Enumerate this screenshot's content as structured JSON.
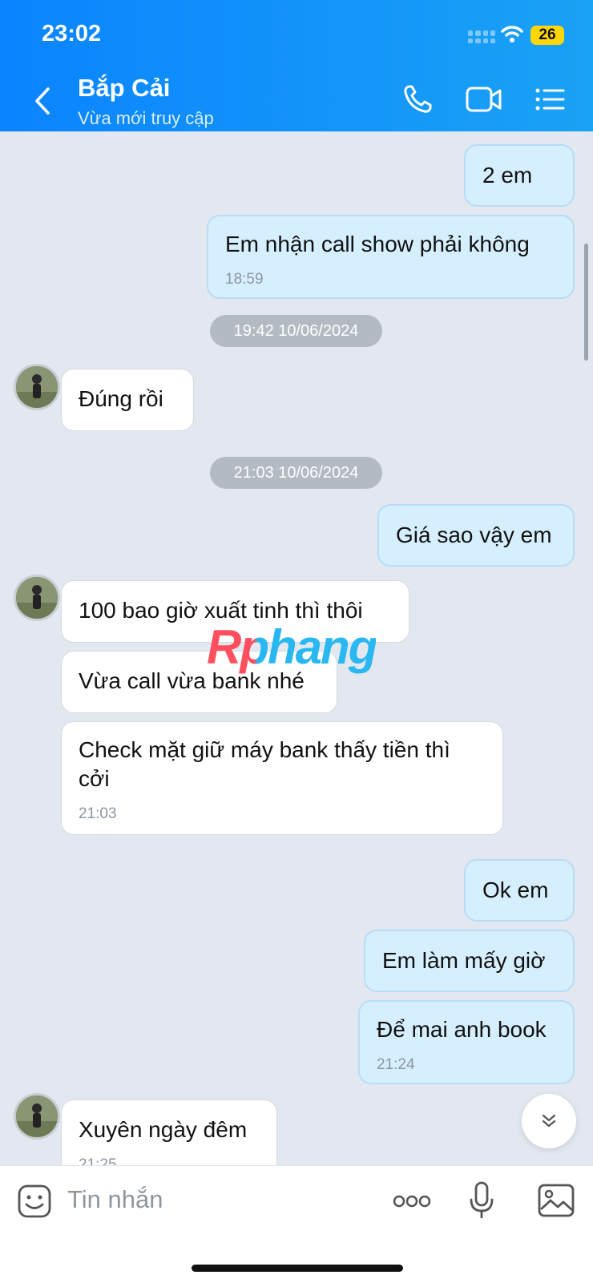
{
  "status_bar": {
    "time": "23:02",
    "battery": "26"
  },
  "header": {
    "name": "Bắp Cải",
    "status": "Vừa mới truy cập"
  },
  "messages": [
    {
      "text": "2 em"
    },
    {
      "text": "Em nhận call show phải không",
      "time": "18:59"
    },
    {
      "date": "19:42 10/06/2024"
    },
    {
      "text": "Đúng rồi"
    },
    {
      "date": "21:03 10/06/2024"
    },
    {
      "text": "Giá sao vậy em"
    },
    {
      "text": "100 bao giờ xuất tinh thì thôi"
    },
    {
      "text": "Vừa call vừa bank nhé"
    },
    {
      "text": "Check mặt giữ máy bank thấy tiền thì cởi",
      "time": "21:03"
    },
    {
      "text": "Ok em"
    },
    {
      "text": "Em làm mấy giờ"
    },
    {
      "text": "Để mai anh book",
      "time": "21:24"
    },
    {
      "text": "Xuyên ngày đêm",
      "time": "21:25"
    }
  ],
  "watermark": "Rphang",
  "input": {
    "placeholder": "Tin nhắn"
  },
  "icons": [
    "back-icon",
    "phone-icon",
    "video-call-icon",
    "menu-icon",
    "sticker-icon",
    "more-icon",
    "microphone-icon",
    "image-icon",
    "chevron-down-icon"
  ]
}
